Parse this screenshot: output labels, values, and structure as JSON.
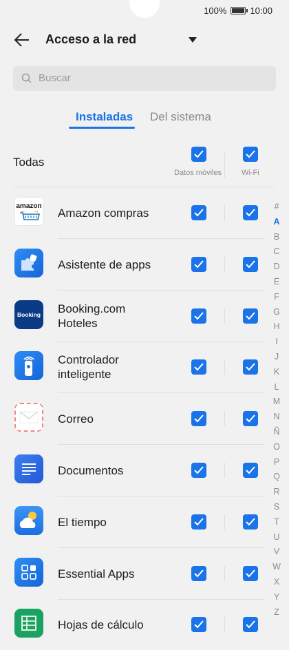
{
  "status": {
    "battery": "100%",
    "time": "10:00"
  },
  "header": {
    "title": "Acceso a la red"
  },
  "search": {
    "placeholder": "Buscar"
  },
  "tabs": [
    {
      "label": "Instaladas"
    },
    {
      "label": "Del sistema"
    }
  ],
  "summary": {
    "label": "Todas",
    "col_mobile": "Datos móviles",
    "col_wifi": "Wi-Fi",
    "mobile_checked": true,
    "wifi_checked": true
  },
  "apps": [
    {
      "name": "Amazon compras",
      "icon": "amazon-icon",
      "mobile": true,
      "wifi": true
    },
    {
      "name": "Asistente de apps",
      "icon": "puzzle-icon",
      "mobile": true,
      "wifi": true
    },
    {
      "name": "Booking.com Hoteles",
      "icon": "booking-icon",
      "mobile": true,
      "wifi": true
    },
    {
      "name": "Controlador inteligente",
      "icon": "remote-icon",
      "mobile": true,
      "wifi": true
    },
    {
      "name": "Correo",
      "icon": "mail-icon",
      "mobile": true,
      "wifi": true
    },
    {
      "name": "Documentos",
      "icon": "docs-icon",
      "mobile": true,
      "wifi": true
    },
    {
      "name": "El tiempo",
      "icon": "weather-icon",
      "mobile": true,
      "wifi": true
    },
    {
      "name": "Essential Apps",
      "icon": "grid-icon",
      "mobile": true,
      "wifi": true
    },
    {
      "name": "Hojas de cálculo",
      "icon": "sheets-icon",
      "mobile": true,
      "wifi": true
    }
  ],
  "icon_text": {
    "amazon": "amazon",
    "booking": "Booking"
  },
  "alphabet": [
    "#",
    "A",
    "B",
    "C",
    "D",
    "E",
    "F",
    "G",
    "H",
    "I",
    "J",
    "K",
    "L",
    "M",
    "N",
    "Ñ",
    "O",
    "P",
    "Q",
    "R",
    "S",
    "T",
    "U",
    "V",
    "W",
    "X",
    "Y",
    "Z"
  ],
  "alphabet_active": "A",
  "colors": {
    "accent": "#1a73e8",
    "background": "#f1f1f1"
  }
}
